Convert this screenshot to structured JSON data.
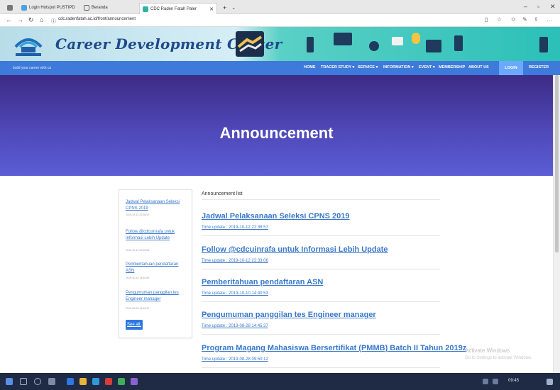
{
  "browser": {
    "tabs": [
      {
        "label": "Login Hotspot PUSTIPD"
      },
      {
        "label": "Beranda"
      },
      {
        "label": "CDC Raden Fatah Paler"
      }
    ],
    "url": "cdc.radenfatah.ac.id/front/announcement",
    "window_controls": {
      "minimize": "–",
      "maximize": "▫",
      "close": "✕"
    },
    "nav": {
      "back": "←",
      "forward": "→",
      "refresh": "↻",
      "home": "⌂"
    },
    "new_tab": "+"
  },
  "site": {
    "title": "Career Development Center",
    "tagline": "build your career with us",
    "nav": {
      "home": "HOME",
      "tracer": "TRACER STUDY ▾",
      "service": "SERVICE ▾",
      "information": "INFORMATION ▾",
      "event": "EVENT ▾",
      "membership": "MEMBERSHIP",
      "about": "ABOUT US",
      "login": "LOGIN",
      "register": "REGISTER"
    },
    "accent": "#3d7ad9"
  },
  "hero": {
    "title": "Announcement"
  },
  "sidebar": {
    "items": [
      {
        "title": "Jadwal Pelaksanaan Seleksi CPNS 2019",
        "date": "2019-10-12 22:36:57"
      },
      {
        "title": "Follow @cdcuinrafa untuk Informasi Lebih Update",
        "date": "2019-10-12 22:33:06"
      },
      {
        "title": "Pemberitahuan pendaftaran ASN",
        "date": "2019-10-10 14:40:53"
      },
      {
        "title": "Pengumuman panggilan tes Engineer manager",
        "date": "2019-08-28 14:45:37"
      }
    ],
    "see_all": "See all."
  },
  "main": {
    "list_title": "Announcement list",
    "items": [
      {
        "title": "Jadwal Pelaksanaan Seleksi CPNS 2019",
        "time": "Time update : 2019-10-12 22:36:57"
      },
      {
        "title": "Follow @cdcuinrafa untuk Informasi Lebih Update",
        "time": "Time update : 2019-10-12 22:33:06"
      },
      {
        "title": "Pemberitahuan pendaftaran ASN",
        "time": "Time update : 2019-10-10 14:40:53"
      },
      {
        "title": "Pengumuman panggilan tes Engineer manager",
        "time": "Time update : 2019-08-28 14:45:37"
      },
      {
        "title": "Program Magang Mahasiswa Bersertifikat (PMMB) Batch II Tahun 2019z",
        "time": "Time update : 2019-08-28 09:50:12"
      }
    ]
  },
  "watermark": {
    "line1": "Activate Windows",
    "line2": "Go to Settings to activate Windows."
  },
  "taskbar": {
    "clock": "09:45"
  }
}
